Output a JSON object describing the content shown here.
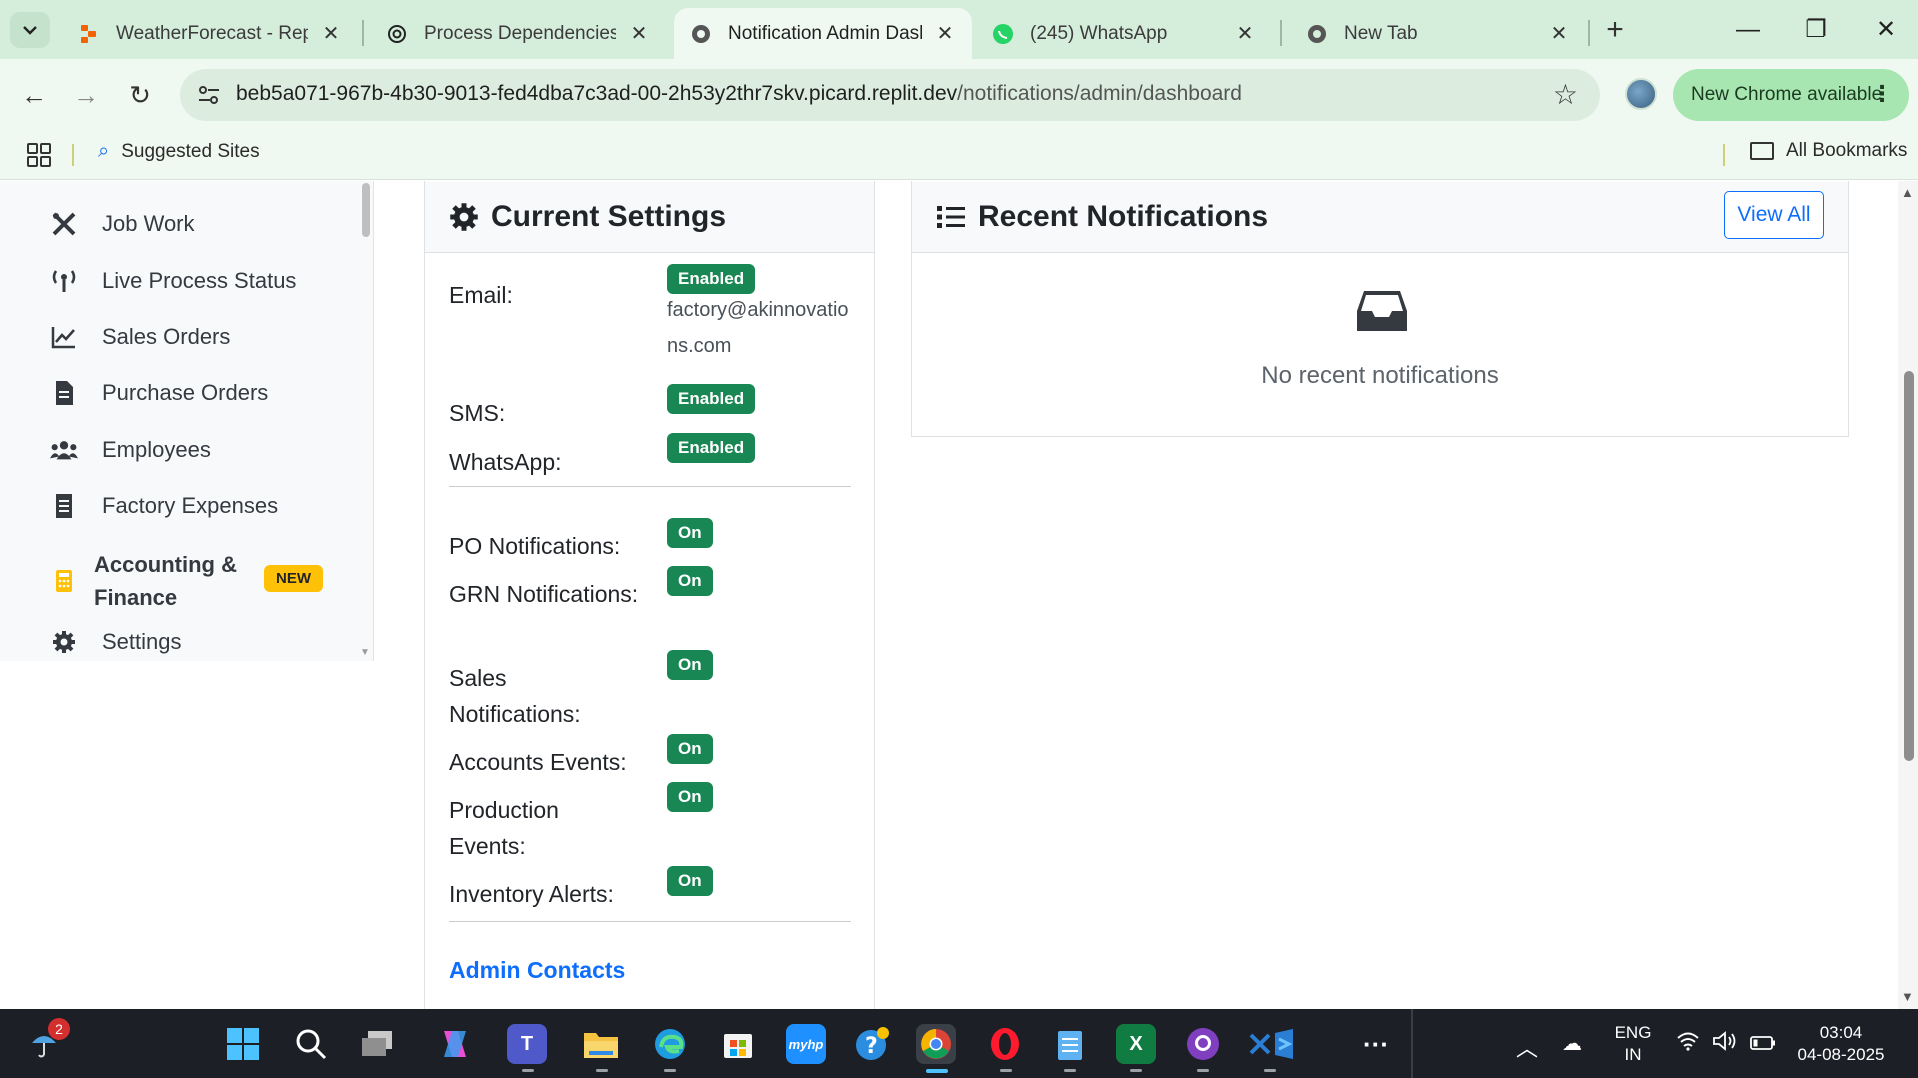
{
  "browser": {
    "tabs": [
      {
        "title": "WeatherForecast - Replit",
        "icon": "replit-icon"
      },
      {
        "title": "Process Dependencies O",
        "icon": "openai-icon"
      },
      {
        "title": "Notification Admin Dashb",
        "icon": "globe-icon",
        "active": true
      },
      {
        "title": "(245) WhatsApp",
        "icon": "whatsapp-icon"
      },
      {
        "title": "New Tab",
        "icon": "chrome-icon"
      }
    ],
    "url_host": "beb5a071-967b-4b30-9013-fed4dba7c3ad-00-2h53y2thr7skv.picard.replit.dev",
    "url_path": "/notifications/admin/dashboard",
    "update_label": "New Chrome available",
    "bookmarks": {
      "suggested": "Suggested Sites",
      "all": "All Bookmarks"
    }
  },
  "sidebar": {
    "items": [
      {
        "label": "Job Work",
        "icon": "tools-icon"
      },
      {
        "label": "Live Process Status",
        "icon": "broadcast-icon"
      },
      {
        "label": "Sales Orders",
        "icon": "line-chart-icon"
      },
      {
        "label": "Purchase Orders",
        "icon": "document-icon"
      },
      {
        "label": "Employees",
        "icon": "users-icon"
      },
      {
        "label": "Factory Expenses",
        "icon": "receipt-icon"
      },
      {
        "label": "Accounting & Finance",
        "label_line1": "Accounting &",
        "label_line2": "Finance",
        "icon": "calculator-icon",
        "badge": "NEW"
      },
      {
        "label": "Settings",
        "icon": "gear-icon"
      }
    ]
  },
  "settings_card": {
    "title": "Current Settings",
    "channels": [
      {
        "label": "Email:",
        "status": "Enabled",
        "detail": "factory@akinnovations.com"
      },
      {
        "label": "SMS:",
        "status": "Enabled"
      },
      {
        "label": "WhatsApp:",
        "status": "Enabled"
      }
    ],
    "events": [
      {
        "label": "PO Notifications:",
        "status": "On"
      },
      {
        "label": "GRN Notifications:",
        "status": "On"
      },
      {
        "label": "Sales Notifications:",
        "status": "On"
      },
      {
        "label": "Accounts Events:",
        "status": "On"
      },
      {
        "label": "Production Events:",
        "status": "On"
      },
      {
        "label": "Inventory Alerts:",
        "status": "On"
      }
    ],
    "admin_contacts": "Admin Contacts"
  },
  "notifications_card": {
    "title": "Recent Notifications",
    "view_all": "View All",
    "empty_text": "No recent notifications"
  },
  "taskbar": {
    "weather_badge": "2",
    "lang_line1": "ENG",
    "lang_line2": "IN",
    "time": "03:04",
    "date": "04-08-2025"
  },
  "colors": {
    "success": "#198754",
    "primary": "#0d6efd",
    "warning": "#ffc107",
    "chrome_frame": "#d5eddb"
  }
}
